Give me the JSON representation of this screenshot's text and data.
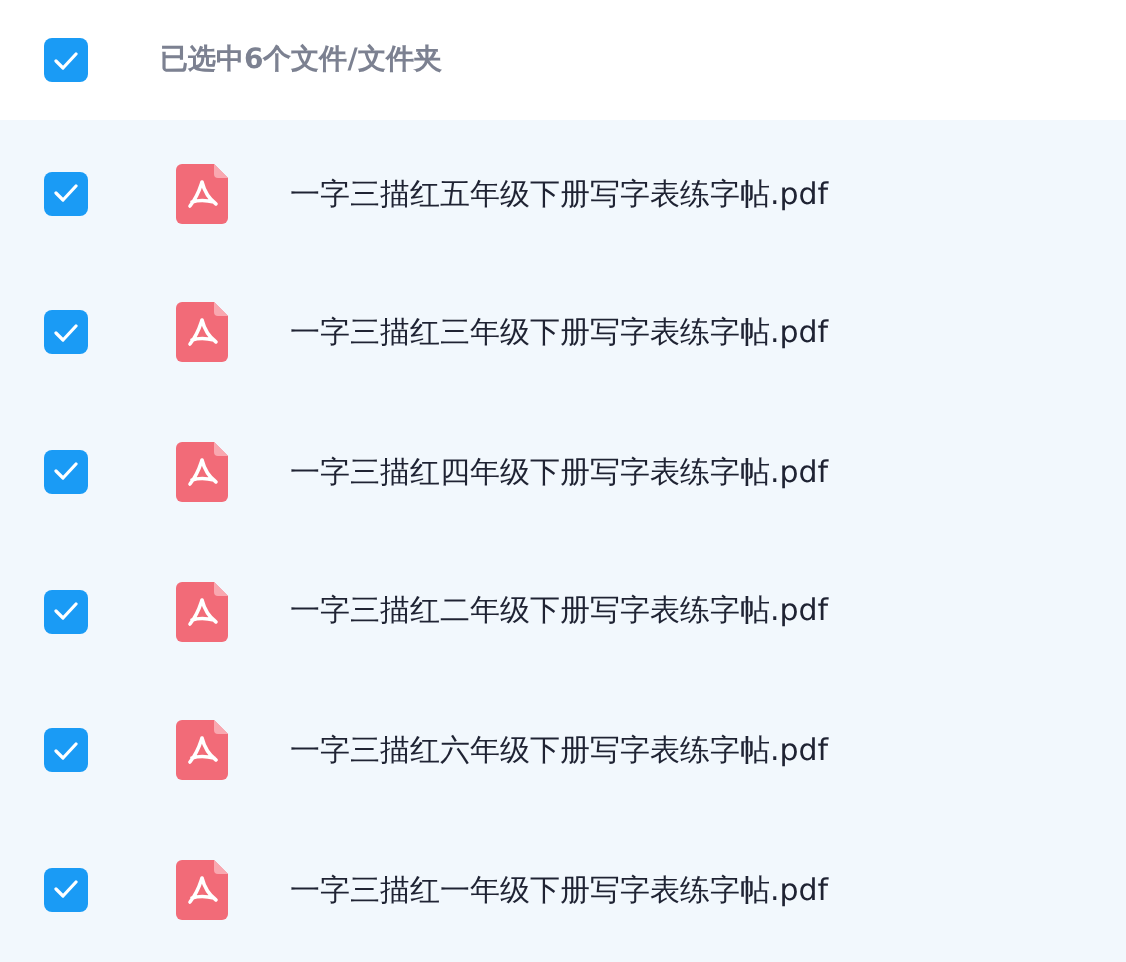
{
  "header": {
    "checked": true,
    "label": "已选中6个文件/文件夹"
  },
  "files": [
    {
      "name": "一字三描红五年级下册写字表练字帖.pdf",
      "checked": true,
      "kind": "pdf"
    },
    {
      "name": "一字三描红三年级下册写字表练字帖.pdf",
      "checked": true,
      "kind": "pdf"
    },
    {
      "name": "一字三描红四年级下册写字表练字帖.pdf",
      "checked": true,
      "kind": "pdf"
    },
    {
      "name": "一字三描红二年级下册写字表练字帖.pdf",
      "checked": true,
      "kind": "pdf"
    },
    {
      "name": "一字三描红六年级下册写字表练字帖.pdf",
      "checked": true,
      "kind": "pdf"
    },
    {
      "name": "一字三描红一年级下册写字表练字帖.pdf",
      "checked": true,
      "kind": "pdf"
    }
  ]
}
